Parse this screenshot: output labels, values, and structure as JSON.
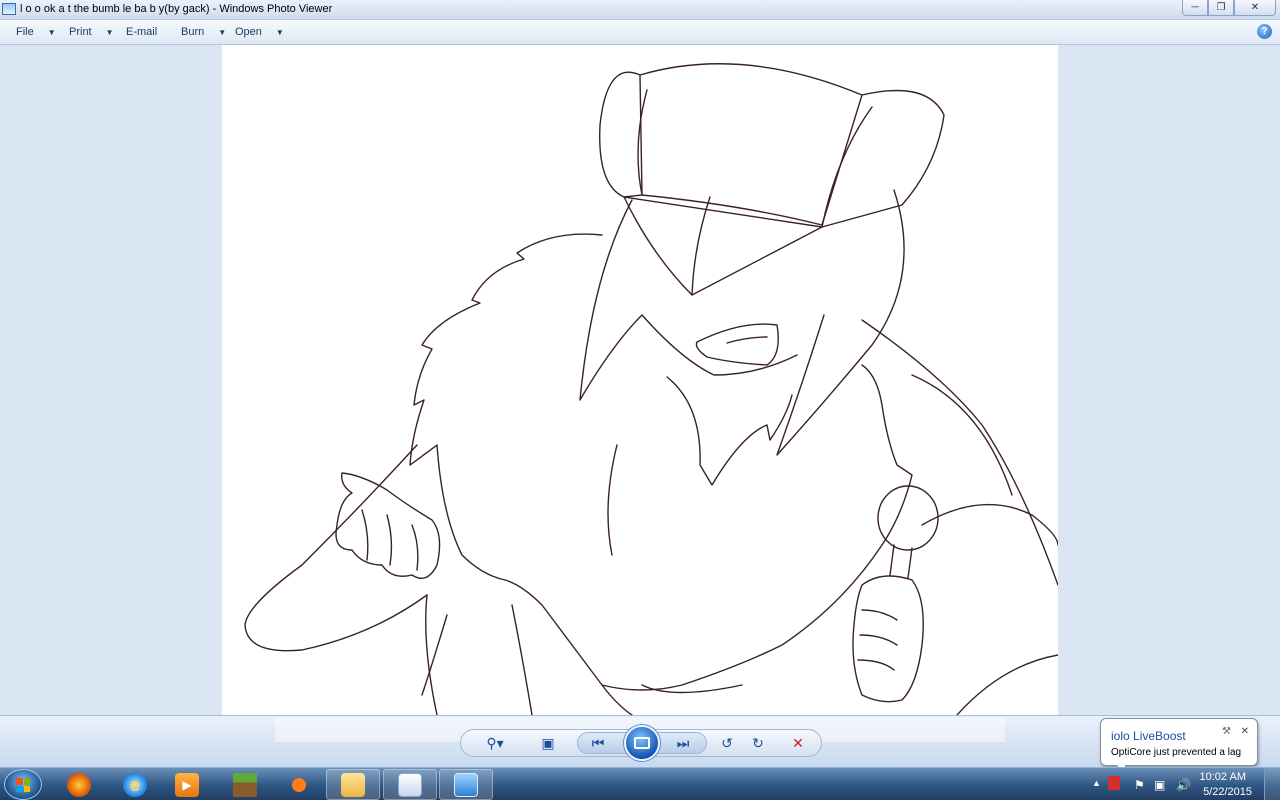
{
  "window": {
    "title": "l o o ok a t the bumb le ba b y(by gack) - Windows Photo Viewer"
  },
  "menu": {
    "items": [
      {
        "label": "File",
        "has_dropdown": true
      },
      {
        "label": "Print",
        "has_dropdown": true
      },
      {
        "label": "E-mail",
        "has_dropdown": false
      },
      {
        "label": "Burn",
        "has_dropdown": true
      },
      {
        "label": "Open",
        "has_dropdown": true
      }
    ],
    "help_label": "?"
  },
  "controls": {
    "icons": [
      "zoom-icon",
      "actual-size-icon",
      "previous-icon",
      "slideshow-icon",
      "next-icon",
      "rotate-ccw-icon",
      "rotate-cw-icon",
      "delete-icon"
    ],
    "delete_color": "#d21f1f",
    "accent_color": "#1d4e9a"
  },
  "notification": {
    "title": "iolo LiveBoost",
    "message": "OptiCore just prevented a lag"
  },
  "taskbar": {
    "apps": [
      "firefox",
      "internet-explorer",
      "media-player",
      "minecraft",
      "fish-game",
      "file-explorer",
      "paint",
      "photo-viewer"
    ],
    "active_app": "photo-viewer",
    "time": "10:02 AM",
    "date": "5/22/2015"
  },
  "colors": {
    "line_art": "#3b2222",
    "taskbar": "#2e5683",
    "window_chrome": "#dbe6f4"
  }
}
